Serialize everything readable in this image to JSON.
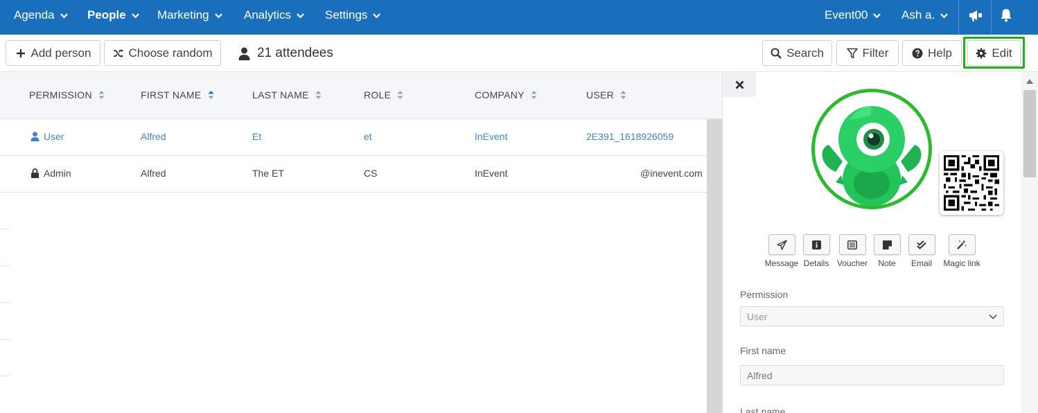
{
  "nav": {
    "items": [
      "Agenda",
      "People",
      "Marketing",
      "Analytics",
      "Settings"
    ],
    "event": "Event00",
    "user": "Ash a.",
    "accent": "#1a6fbd"
  },
  "toolbar": {
    "add_person": "Add person",
    "choose_random": "Choose random",
    "attendees": "21 attendees",
    "search": "Search",
    "filter": "Filter",
    "help": "Help",
    "edit": "Edit",
    "highlight_color": "#1bb21b"
  },
  "table": {
    "columns": [
      "PERMISSION",
      "FIRST NAME",
      "LAST NAME",
      "ROLE",
      "COMPANY",
      "USER"
    ],
    "rows": [
      {
        "permission": "User",
        "first_name": "Alfred",
        "last_name": "Et",
        "role": "et",
        "company": "InEvent",
        "user": "2E391_1618926059"
      },
      {
        "permission": "Admin",
        "first_name": "Alfred",
        "last_name": "The ET",
        "role": "CS",
        "company": "InEvent",
        "user": "@inevent.com"
      }
    ]
  },
  "panel": {
    "actions": [
      "Message",
      "Details",
      "Voucher",
      "Note",
      "Email",
      "Magic link"
    ],
    "permission_label": "Permission",
    "permission_value": "User",
    "first_name_label": "First name",
    "first_name_value": "Alfred",
    "last_name_label": "Last name"
  }
}
